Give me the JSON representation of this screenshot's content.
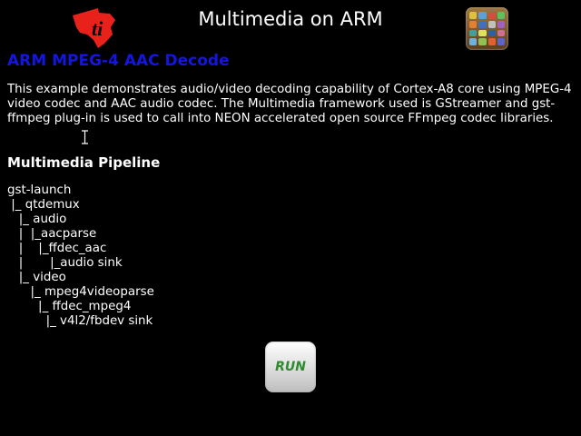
{
  "header": {
    "title": "Multimedia on ARM",
    "logo": "ti-logo",
    "home_button": "apps-grid-icon"
  },
  "main": {
    "heading": "ARM MPEG-4 AAC Decode",
    "description": "This example demonstrates audio/video decoding capability of Cortex-A8 core using MPEG-4 video codec and AAC audio codec. The Multimedia framework used is GStreamer and gst-ffmpeg plug-in is used to call into NEON accelerated open source FFmpeg codec libraries.",
    "pipeline_title": "Multimedia Pipeline",
    "pipeline_lines": [
      "gst-launch",
      " |_ qtdemux",
      "   |_ audio",
      "   |  |_aacparse",
      "   |    |_ffdec_aac",
      "   |       |_audio sink",
      "   |_ video",
      "      |_ mpeg4videoparse",
      "        |_ ffdec_mpeg4",
      "          |_ v4l2/fbdev sink"
    ]
  },
  "run_button": {
    "label": "RUN"
  },
  "colors": {
    "heading": "#1515e0",
    "logo": "#e8211a",
    "run_label": "#2e8b2e",
    "background": "#000000"
  }
}
